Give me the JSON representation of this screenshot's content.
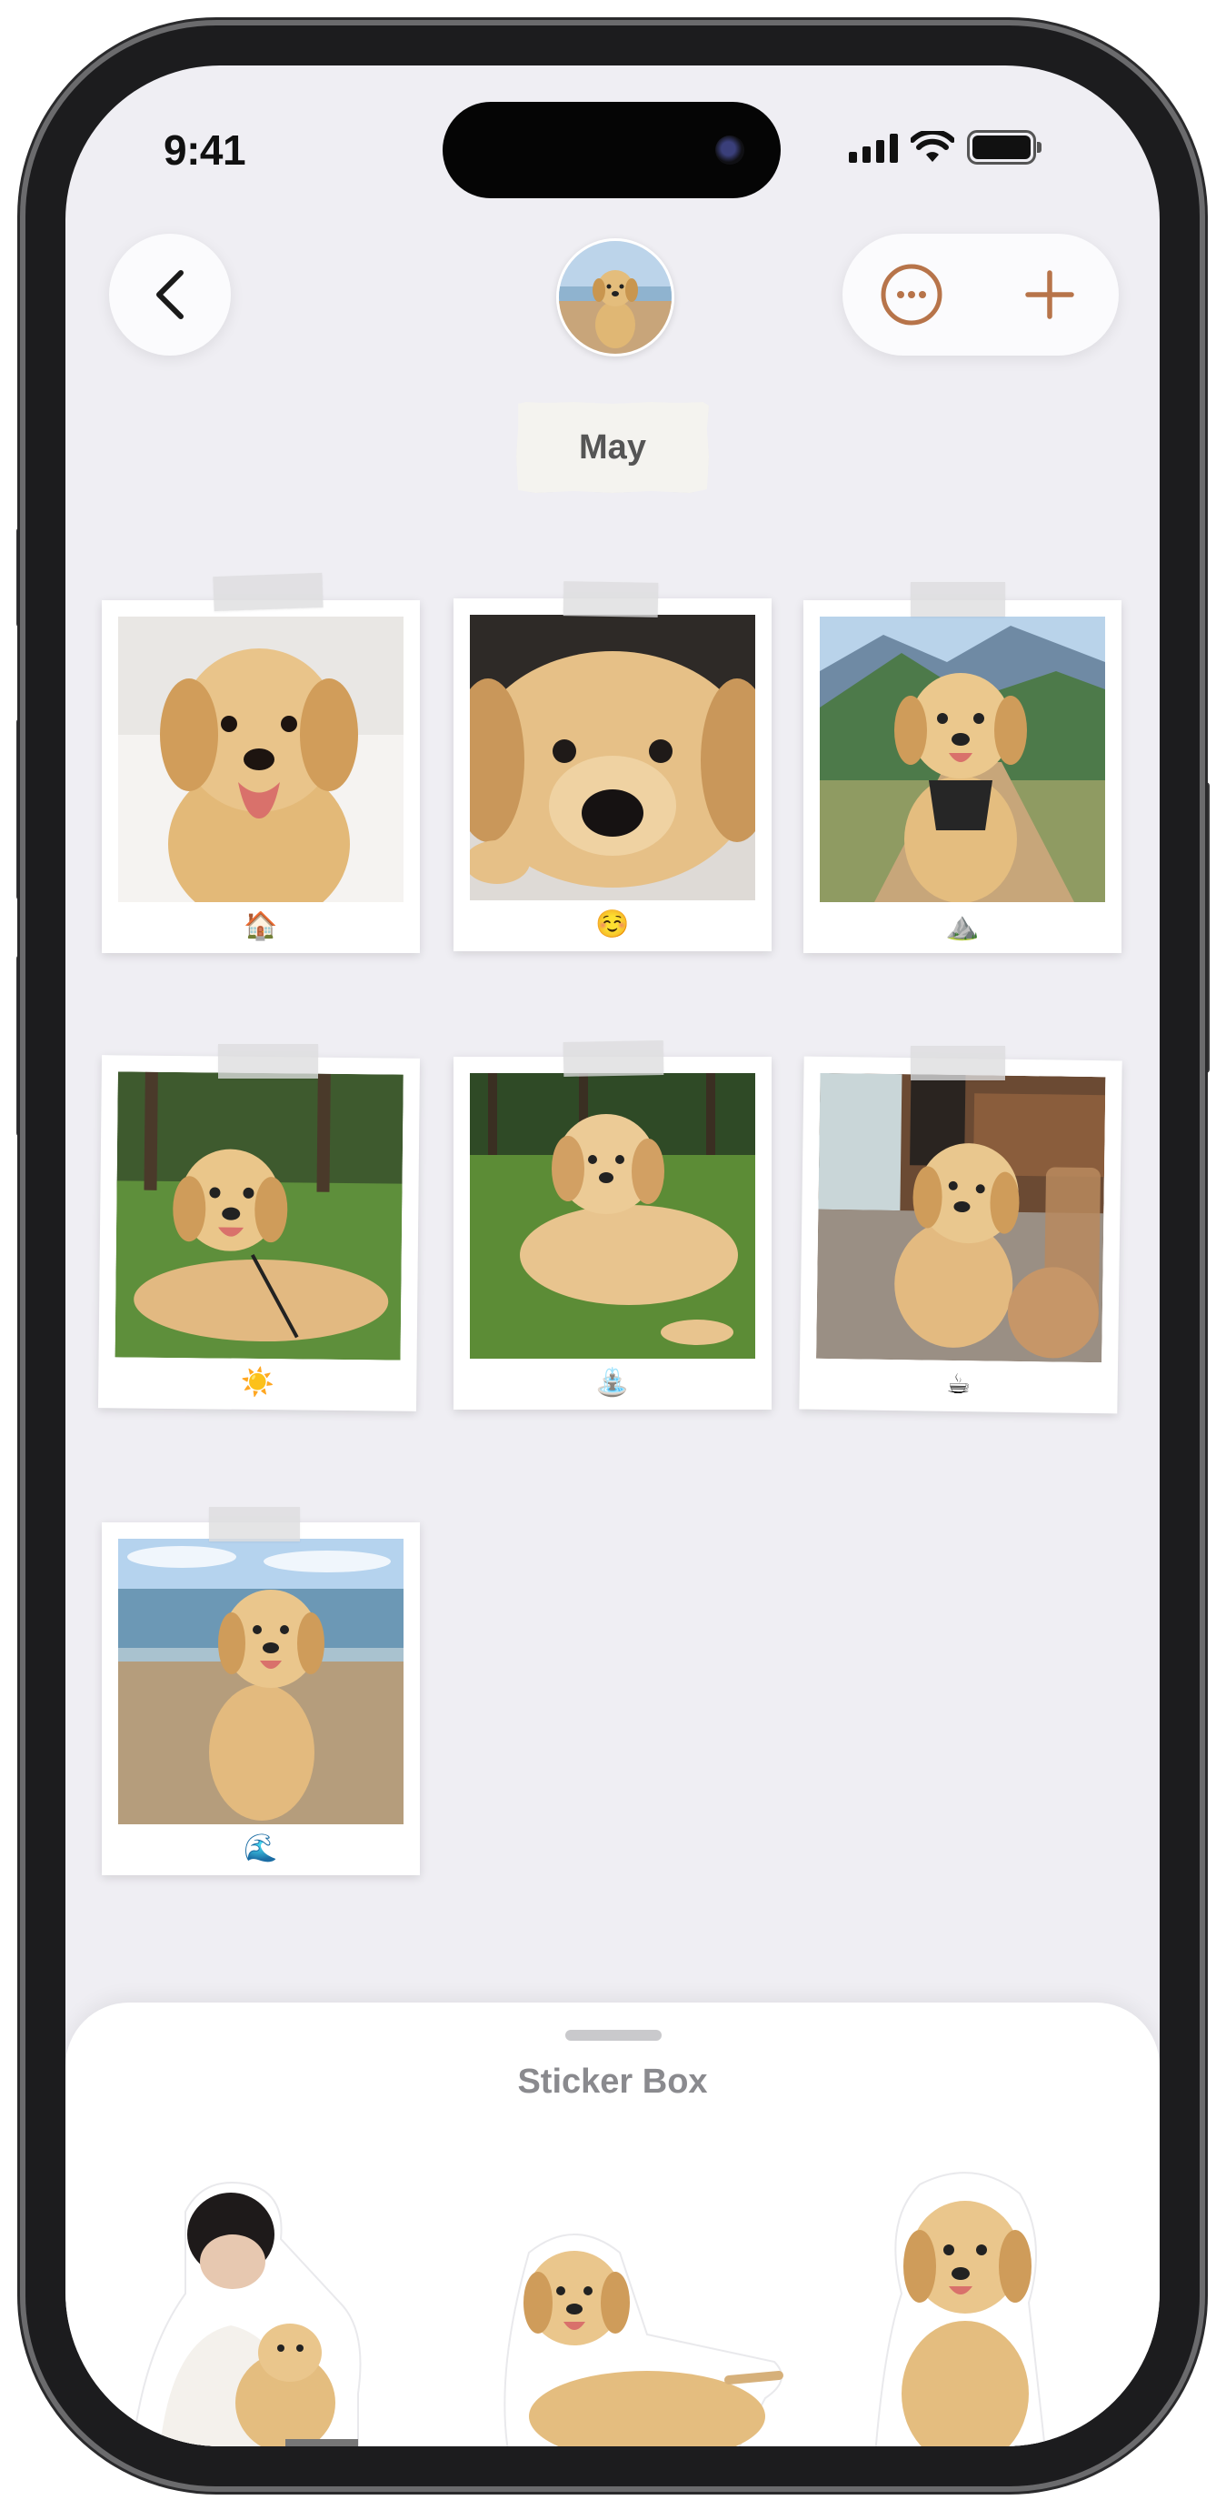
{
  "status_bar": {
    "time": "9:41"
  },
  "header": {
    "month_label": "May"
  },
  "icons": {
    "back": "chevron-left-icon",
    "more": "ellipsis-circle-icon",
    "add": "plus-icon",
    "accent_color": "#b7744a"
  },
  "photos": [
    {
      "emoji": "🏠",
      "scene": "puppy-indoors-on-bed"
    },
    {
      "emoji": "☺️",
      "scene": "puppy-closeup-lying"
    },
    {
      "emoji": "⛰️",
      "scene": "puppy-mountain-trail"
    },
    {
      "emoji": "☀️",
      "scene": "puppy-park-grass"
    },
    {
      "emoji": "⛲",
      "scene": "puppy-lying-grass"
    },
    {
      "emoji": "☕",
      "scene": "puppy-cafe"
    },
    {
      "emoji": "🌊",
      "scene": "puppy-beach"
    }
  ],
  "sticker_box": {
    "title": "Sticker Box",
    "stickers": [
      "person-with-puppy-sticker",
      "puppy-lying-sticker",
      "puppy-sitting-sticker"
    ]
  }
}
